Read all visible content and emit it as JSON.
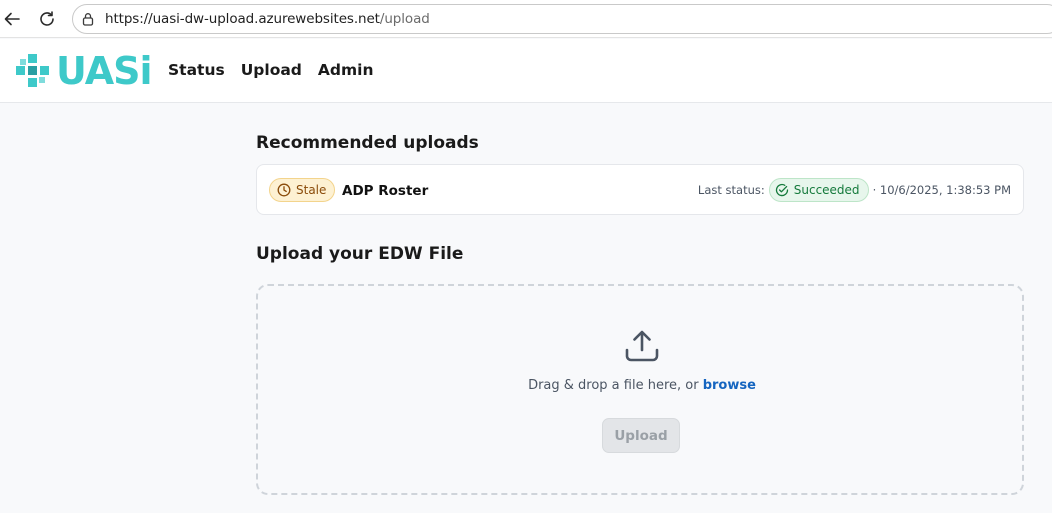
{
  "browser": {
    "url_host": "https://uasi-dw-upload.azurewebsites.net",
    "url_path": "/upload",
    "back_icon": "arrow-left-icon",
    "reload_icon": "reload-icon",
    "lock_icon": "lock-icon"
  },
  "header": {
    "logo_text": "UASi",
    "nav": [
      {
        "label": "Status"
      },
      {
        "label": "Upload"
      },
      {
        "label": "Admin"
      }
    ]
  },
  "recommended": {
    "title": "Recommended uploads",
    "items": [
      {
        "badge": "Stale",
        "name": "ADP Roster",
        "last_status_label": "Last status:",
        "status": "Succeeded",
        "timestamp": "· 10/6/2025, 1:38:53 PM"
      }
    ]
  },
  "upload": {
    "title": "Upload your EDW File",
    "drop_text": "Drag & drop a file here, or ",
    "browse_label": "browse",
    "button_label": "Upload",
    "button_enabled": false
  },
  "colors": {
    "brand": "#3ec9c9",
    "link": "#1565c0",
    "stale_bg": "#fdf1d3",
    "success_bg": "#e7f6ec"
  }
}
